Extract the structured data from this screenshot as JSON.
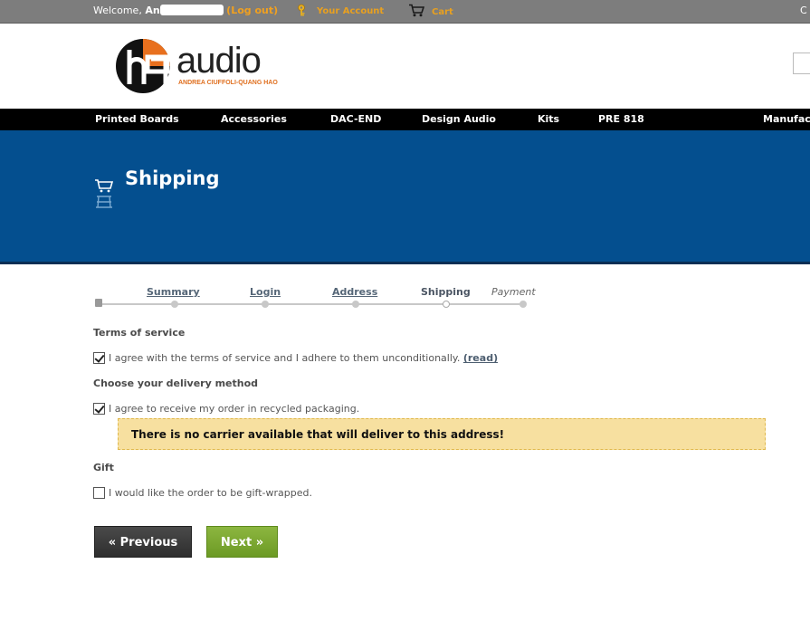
{
  "topbar": {
    "welcome_prefix": "Welcome, ",
    "user_initial": "An",
    "logout": "(Log out)",
    "your_account": "Your Account",
    "cart": "Cart",
    "cut_text": "C"
  },
  "header": {
    "logo_text": "audio",
    "logo_tagline": "ANDREA CIUFFOLI-QUANG HAO"
  },
  "nav": {
    "items": [
      "Printed Boards",
      "Accessories",
      "DAC-END",
      "Design Audio",
      "Kits",
      "PRE 818",
      "Manufac"
    ]
  },
  "banner": {
    "title": "Shipping"
  },
  "steps": {
    "items": [
      "Summary",
      "Login",
      "Address",
      "Shipping",
      "Payment"
    ],
    "current": "Shipping"
  },
  "form": {
    "terms_heading": "Terms of service",
    "terms_text": "I agree with the terms of service and I adhere to them unconditionally.",
    "terms_read": "(read)",
    "terms_checked": true,
    "delivery_heading": "Choose your delivery method",
    "recycled_text": "I agree to receive my order in recycled packaging.",
    "recycled_checked": true,
    "alert": "There is no carrier available that will deliver to this address!",
    "gift_heading": "Gift",
    "gift_text": "I would like the order to be gift-wrapped.",
    "gift_checked": false
  },
  "buttons": {
    "previous": "« Previous",
    "next": "Next »"
  },
  "colors": {
    "banner": "#044f8f",
    "accent_orange": "#e8a020",
    "alert_bg": "#f7e0a0",
    "next_green": "#7ca832"
  }
}
